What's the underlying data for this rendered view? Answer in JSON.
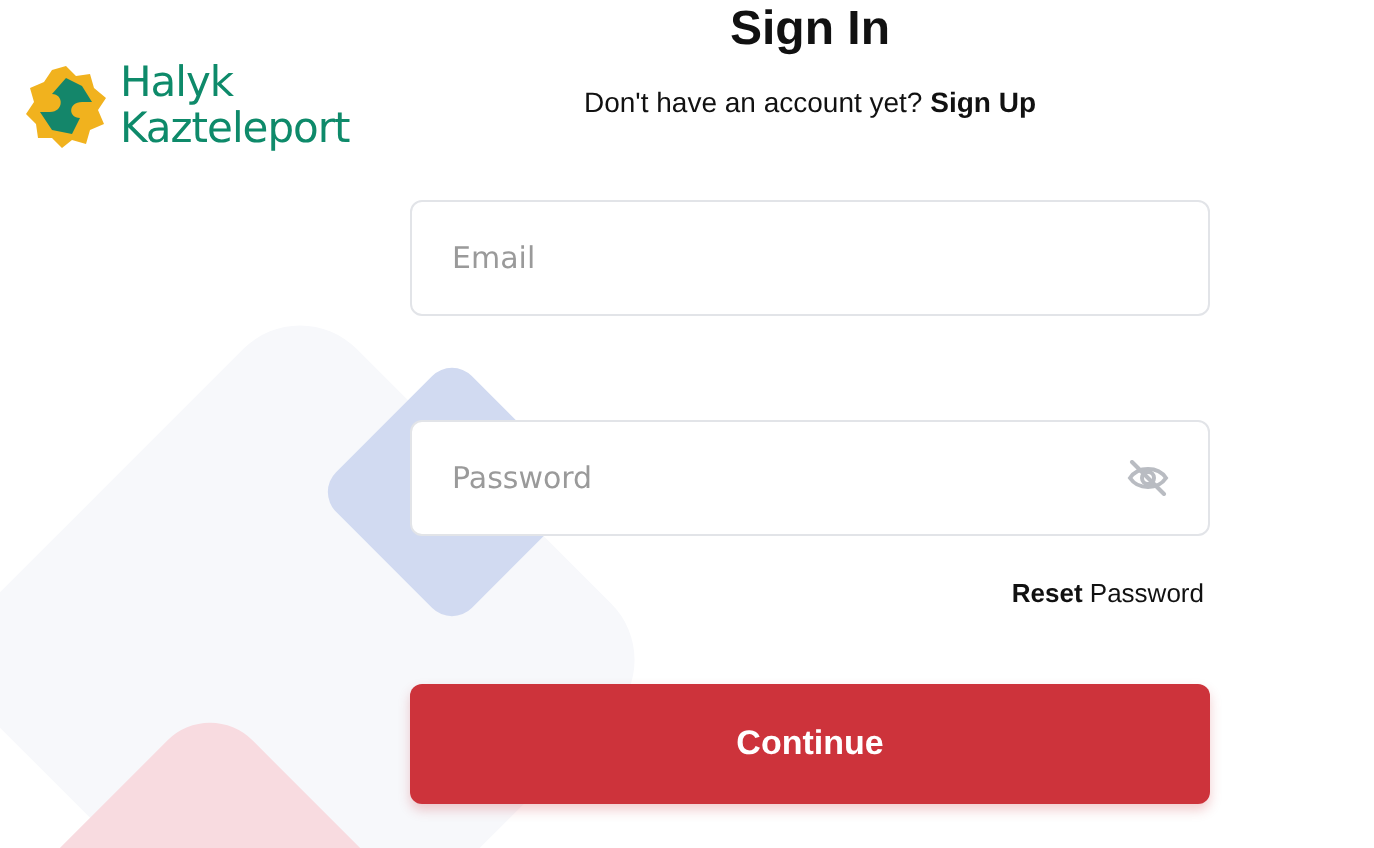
{
  "logo": {
    "line_1": "Halyk",
    "line_2": "Kazteleport"
  },
  "title": "Sign In",
  "signup_prompt": {
    "text": "Don't have an account yet?",
    "link": "Sign Up"
  },
  "fields": [
    {
      "kind": "email",
      "placeholder": "Email"
    },
    {
      "kind": "password",
      "placeholder": "Password",
      "password_hidden": true
    }
  ],
  "reset_link": "**Reset** Password",
  "submit_button": "Continue"
}
